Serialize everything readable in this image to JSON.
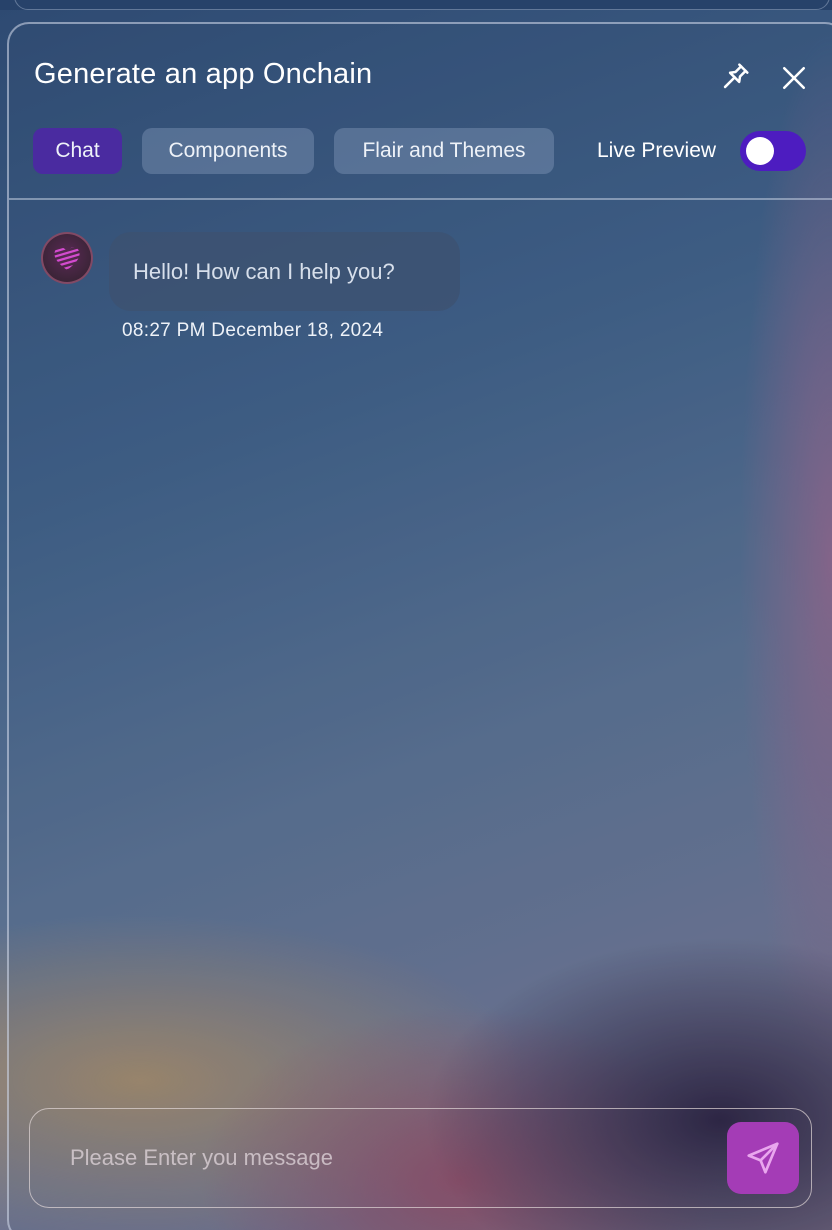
{
  "header": {
    "title": "Generate an app Onchain",
    "pin_icon": "pin-icon",
    "close_icon": "close-icon"
  },
  "tabs": [
    {
      "label": "Chat",
      "active": true
    },
    {
      "label": "Components",
      "active": false
    },
    {
      "label": "Flair and Themes",
      "active": false
    }
  ],
  "live_preview": {
    "label": "Live Preview",
    "enabled": false
  },
  "messages": [
    {
      "sender": "assistant",
      "avatar_icon": "heart-logo-icon",
      "text": "Hello! How can I help you?",
      "timestamp": "08:27 PM December 18, 2024"
    }
  ],
  "composer": {
    "value": "",
    "placeholder": "Please Enter you message",
    "send_icon": "send-icon"
  },
  "colors": {
    "active_tab": "#4a2ba0",
    "toggle": "#4d1cc0",
    "send_button": "#a43cb6"
  }
}
